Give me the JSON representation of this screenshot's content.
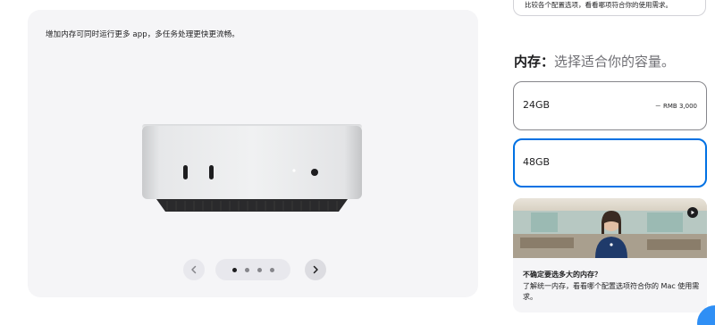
{
  "gallery": {
    "caption": "增加内存可同时运行更多 app，多任务处理更快更流畅。",
    "image_icon": "mac-mini-product-image",
    "pager": {
      "prev_icon": "chevron-left-icon",
      "next_icon": "chevron-right-icon",
      "dot_count": 4,
      "active_dot": 1
    }
  },
  "top_note": {
    "text": "比较各个配置选项，看看哪项符合你的使用需求。"
  },
  "memory_section": {
    "heading": "内存：",
    "subheading": "选择适合你的容量。",
    "options": [
      {
        "name": "24GB",
        "price": "－ RMB 3,000",
        "selected": false
      },
      {
        "name": "48GB",
        "price": "",
        "selected": true
      }
    ]
  },
  "help_card": {
    "title": "不确定要选多大的内存？",
    "text": "了解统一内存，看看哪个配置选项符合你的 Mac 使用需求。",
    "video_icon": "play-icon"
  },
  "colors": {
    "accent": "#0071e3",
    "card_bg": "#f5f5f7",
    "text": "#1d1d1f",
    "secondary_text": "#6e6e73"
  }
}
